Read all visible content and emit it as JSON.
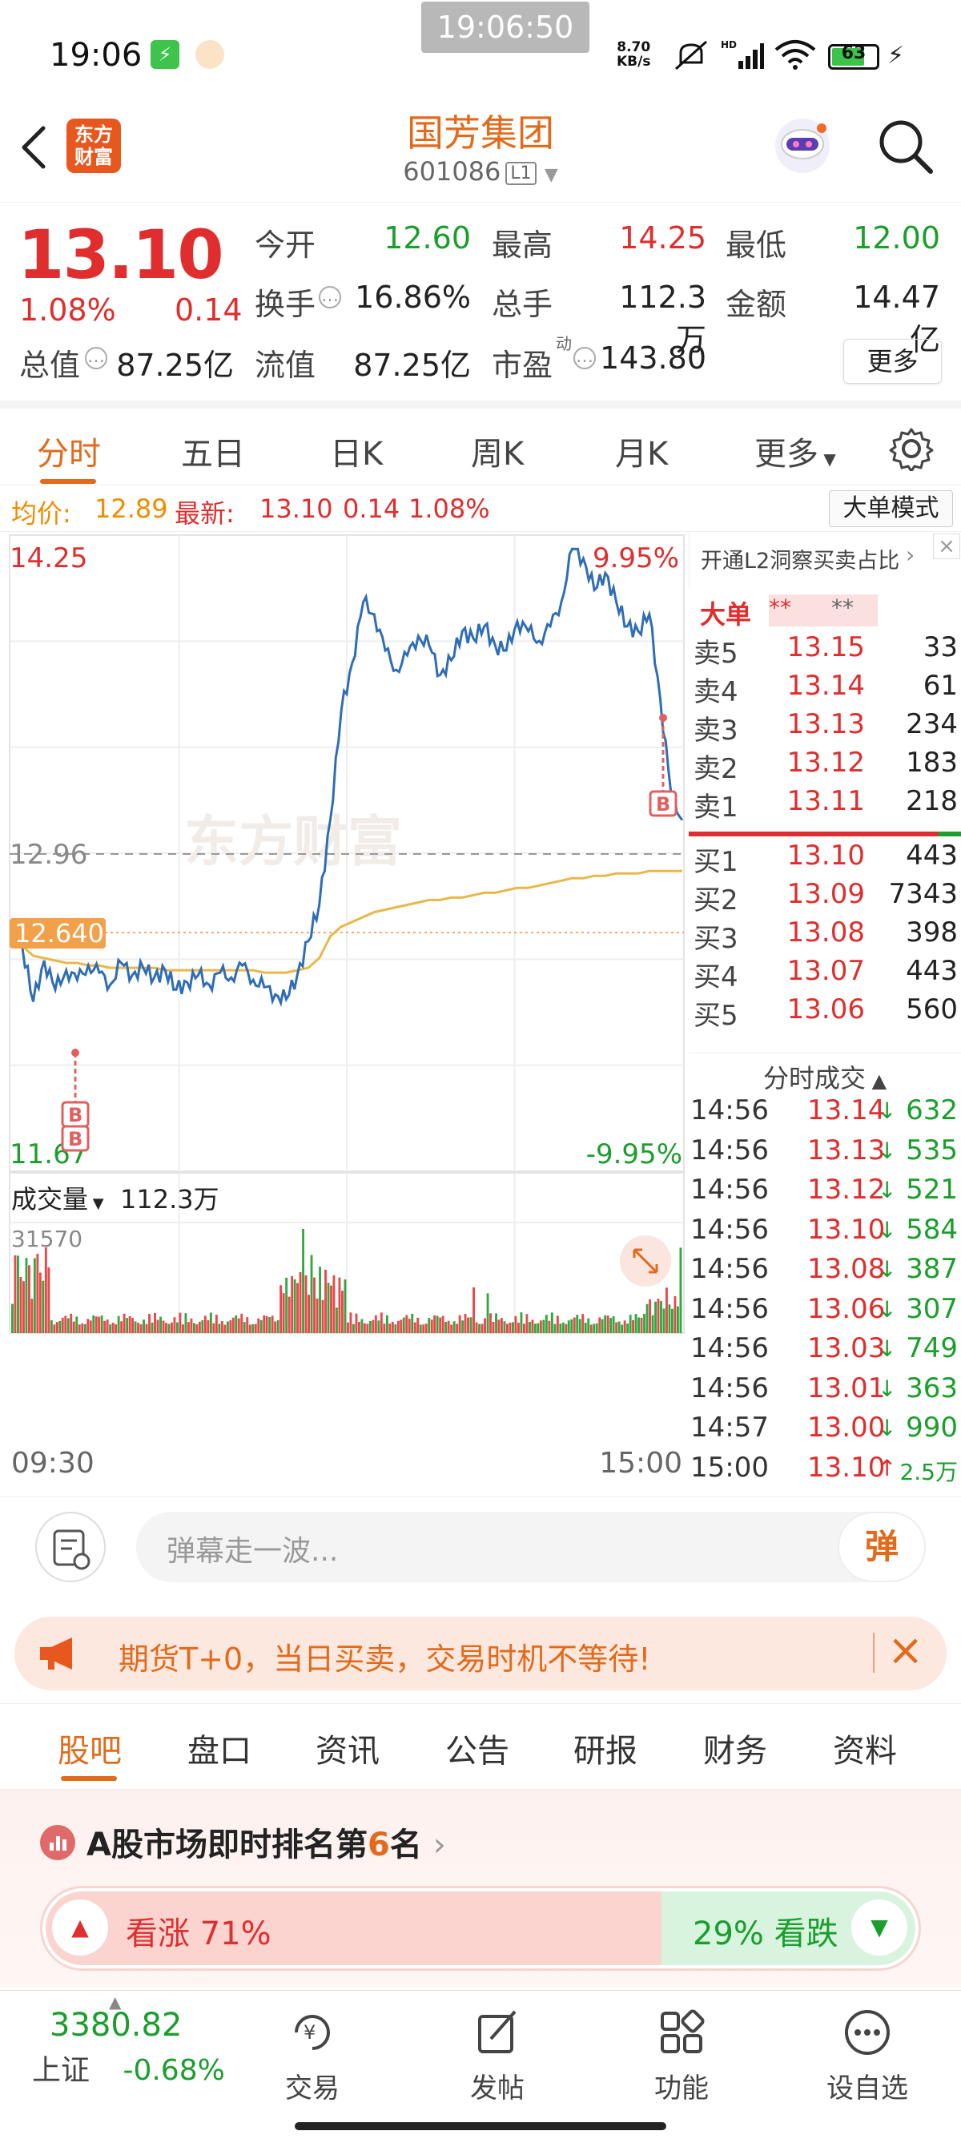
{
  "status_bar": {
    "time": "19:06",
    "center_time": "19:06:50",
    "net_speed": "8.70",
    "net_unit": "KB/s",
    "battery": "63"
  },
  "header": {
    "logo_line1": "东方",
    "logo_line2": "财富",
    "title": "国芳集团",
    "code": "601086",
    "level": "L1"
  },
  "quote": {
    "price": "13.10",
    "pct": "1.08%",
    "change": "0.14",
    "open_label": "今开",
    "open": "12.60",
    "high_label": "最高",
    "high": "14.25",
    "low_label": "最低",
    "low": "12.00",
    "turnover_label": "换手",
    "turnover": "16.86%",
    "volume_label": "总手",
    "volume": "112.3万",
    "amount_label": "金额",
    "amount": "14.47亿",
    "mktcap_label": "总值",
    "mktcap": "87.25亿",
    "float_label": "流值",
    "float": "87.25亿",
    "pe_label": "市盈",
    "pe_sup": "动",
    "pe": "143.80",
    "more": "更多"
  },
  "chart_tabs": [
    "分时",
    "五日",
    "日K",
    "周K",
    "月K",
    "更多"
  ],
  "avg_line": {
    "avg_label": "均价:",
    "avg": "12.89",
    "latest_label": "最新:",
    "latest": "13.10",
    "latest_chg": "0.14",
    "latest_pct": "1.08%",
    "big_mode": "大单模式"
  },
  "chart_labels": {
    "top_price": "14.25",
    "top_pct": "9.95%",
    "mid_price": "12.96",
    "marker_price": "12.640",
    "bottom_price": "11.67",
    "bottom_pct": "-9.95%",
    "volume_label": "成交量",
    "volume_total": "112.3万",
    "volume_max": "31570",
    "time_start": "09:30",
    "time_end": "15:00",
    "watermark": "东方财富",
    "b_marker": "B"
  },
  "chart_data": {
    "type": "line",
    "x_range": [
      "09:30",
      "15:00"
    ],
    "ylim": [
      11.67,
      14.25
    ],
    "reference_price": 12.96,
    "price": [
      12.64,
      12.58,
      12.35,
      12.52,
      12.4,
      12.48,
      12.44,
      12.5,
      12.47,
      12.42,
      12.51,
      12.46,
      12.49,
      12.45,
      12.48,
      12.4,
      12.43,
      12.46,
      12.42,
      12.47,
      12.45,
      12.5,
      12.44,
      12.41,
      12.38,
      12.36,
      12.46,
      12.6,
      12.75,
      13.1,
      13.55,
      13.75,
      14.0,
      13.95,
      13.8,
      13.72,
      13.78,
      13.86,
      13.82,
      13.7,
      13.76,
      13.88,
      13.85,
      13.9,
      13.82,
      13.8,
      13.92,
      13.88,
      13.84,
      13.9,
      14.0,
      14.22,
      14.18,
      14.05,
      14.12,
      14.0,
      13.9,
      13.88,
      13.95,
      13.6,
      13.2,
      13.1
    ],
    "avg_price": [
      12.64,
      12.58,
      12.54,
      12.53,
      12.52,
      12.51,
      12.51,
      12.5,
      12.5,
      12.49,
      12.49,
      12.49,
      12.49,
      12.49,
      12.48,
      12.48,
      12.48,
      12.48,
      12.48,
      12.48,
      12.48,
      12.48,
      12.48,
      12.47,
      12.47,
      12.47,
      12.48,
      12.49,
      12.53,
      12.62,
      12.66,
      12.68,
      12.7,
      12.72,
      12.73,
      12.74,
      12.75,
      12.76,
      12.77,
      12.77,
      12.78,
      12.78,
      12.79,
      12.8,
      12.8,
      12.81,
      12.82,
      12.82,
      12.83,
      12.84,
      12.85,
      12.86,
      12.86,
      12.87,
      12.87,
      12.88,
      12.88,
      12.88,
      12.89,
      12.89,
      12.89,
      12.89
    ],
    "volume_max": 31570
  },
  "order_book": {
    "promo": "开通L2洞察买卖占比",
    "big_label": "大单",
    "big_val1": "**",
    "big_val2": "**",
    "asks": [
      {
        "label": "卖5",
        "price": "13.15",
        "vol": "33"
      },
      {
        "label": "卖4",
        "price": "13.14",
        "vol": "61"
      },
      {
        "label": "卖3",
        "price": "13.13",
        "vol": "234"
      },
      {
        "label": "卖2",
        "price": "13.12",
        "vol": "183"
      },
      {
        "label": "卖1",
        "price": "13.11",
        "vol": "218"
      }
    ],
    "bids": [
      {
        "label": "买1",
        "price": "13.10",
        "vol": "443"
      },
      {
        "label": "买2",
        "price": "13.09",
        "vol": "7343"
      },
      {
        "label": "买3",
        "price": "13.08",
        "vol": "398"
      },
      {
        "label": "买4",
        "price": "13.07",
        "vol": "443"
      },
      {
        "label": "买5",
        "price": "13.06",
        "vol": "560"
      }
    ],
    "ticks_title": "分时成交",
    "ticks": [
      {
        "time": "14:56",
        "price": "13.14",
        "dir": "↓",
        "vol": "632"
      },
      {
        "time": "14:56",
        "price": "13.13",
        "dir": "↓",
        "vol": "535"
      },
      {
        "time": "14:56",
        "price": "13.12",
        "dir": "↓",
        "vol": "521"
      },
      {
        "time": "14:56",
        "price": "13.10",
        "dir": "↓",
        "vol": "584"
      },
      {
        "time": "14:56",
        "price": "13.08",
        "dir": "↓",
        "vol": "387"
      },
      {
        "time": "14:56",
        "price": "13.06",
        "dir": "↓",
        "vol": "307"
      },
      {
        "time": "14:56",
        "price": "13.03",
        "dir": "↓",
        "vol": "749"
      },
      {
        "time": "14:56",
        "price": "13.01",
        "dir": "↓",
        "vol": "363"
      },
      {
        "time": "14:57",
        "price": "13.00",
        "dir": "↓",
        "vol": "990"
      },
      {
        "time": "15:00",
        "price": "13.10",
        "dir": "↑",
        "vol": "2.5万"
      }
    ]
  },
  "danmu": {
    "placeholder": "弹幕走一波...",
    "send": "弹"
  },
  "banner": {
    "text": "期货T+0，当日买卖，交易时机不等待!"
  },
  "info_tabs": [
    "股吧",
    "盘口",
    "资讯",
    "公告",
    "研报",
    "财务",
    "资料"
  ],
  "rank": {
    "prefix": "A股市场即时排名第",
    "rank": "6",
    "suffix": "名",
    "up_label": "看涨 71%",
    "down_label": "29% 看跌",
    "up_fraction": 0.71
  },
  "bottom_nav": {
    "index_value": "3380.82",
    "index_name": "上证",
    "index_change": "-0.68%",
    "items": [
      "交易",
      "发帖",
      "功能",
      "设自选"
    ]
  }
}
